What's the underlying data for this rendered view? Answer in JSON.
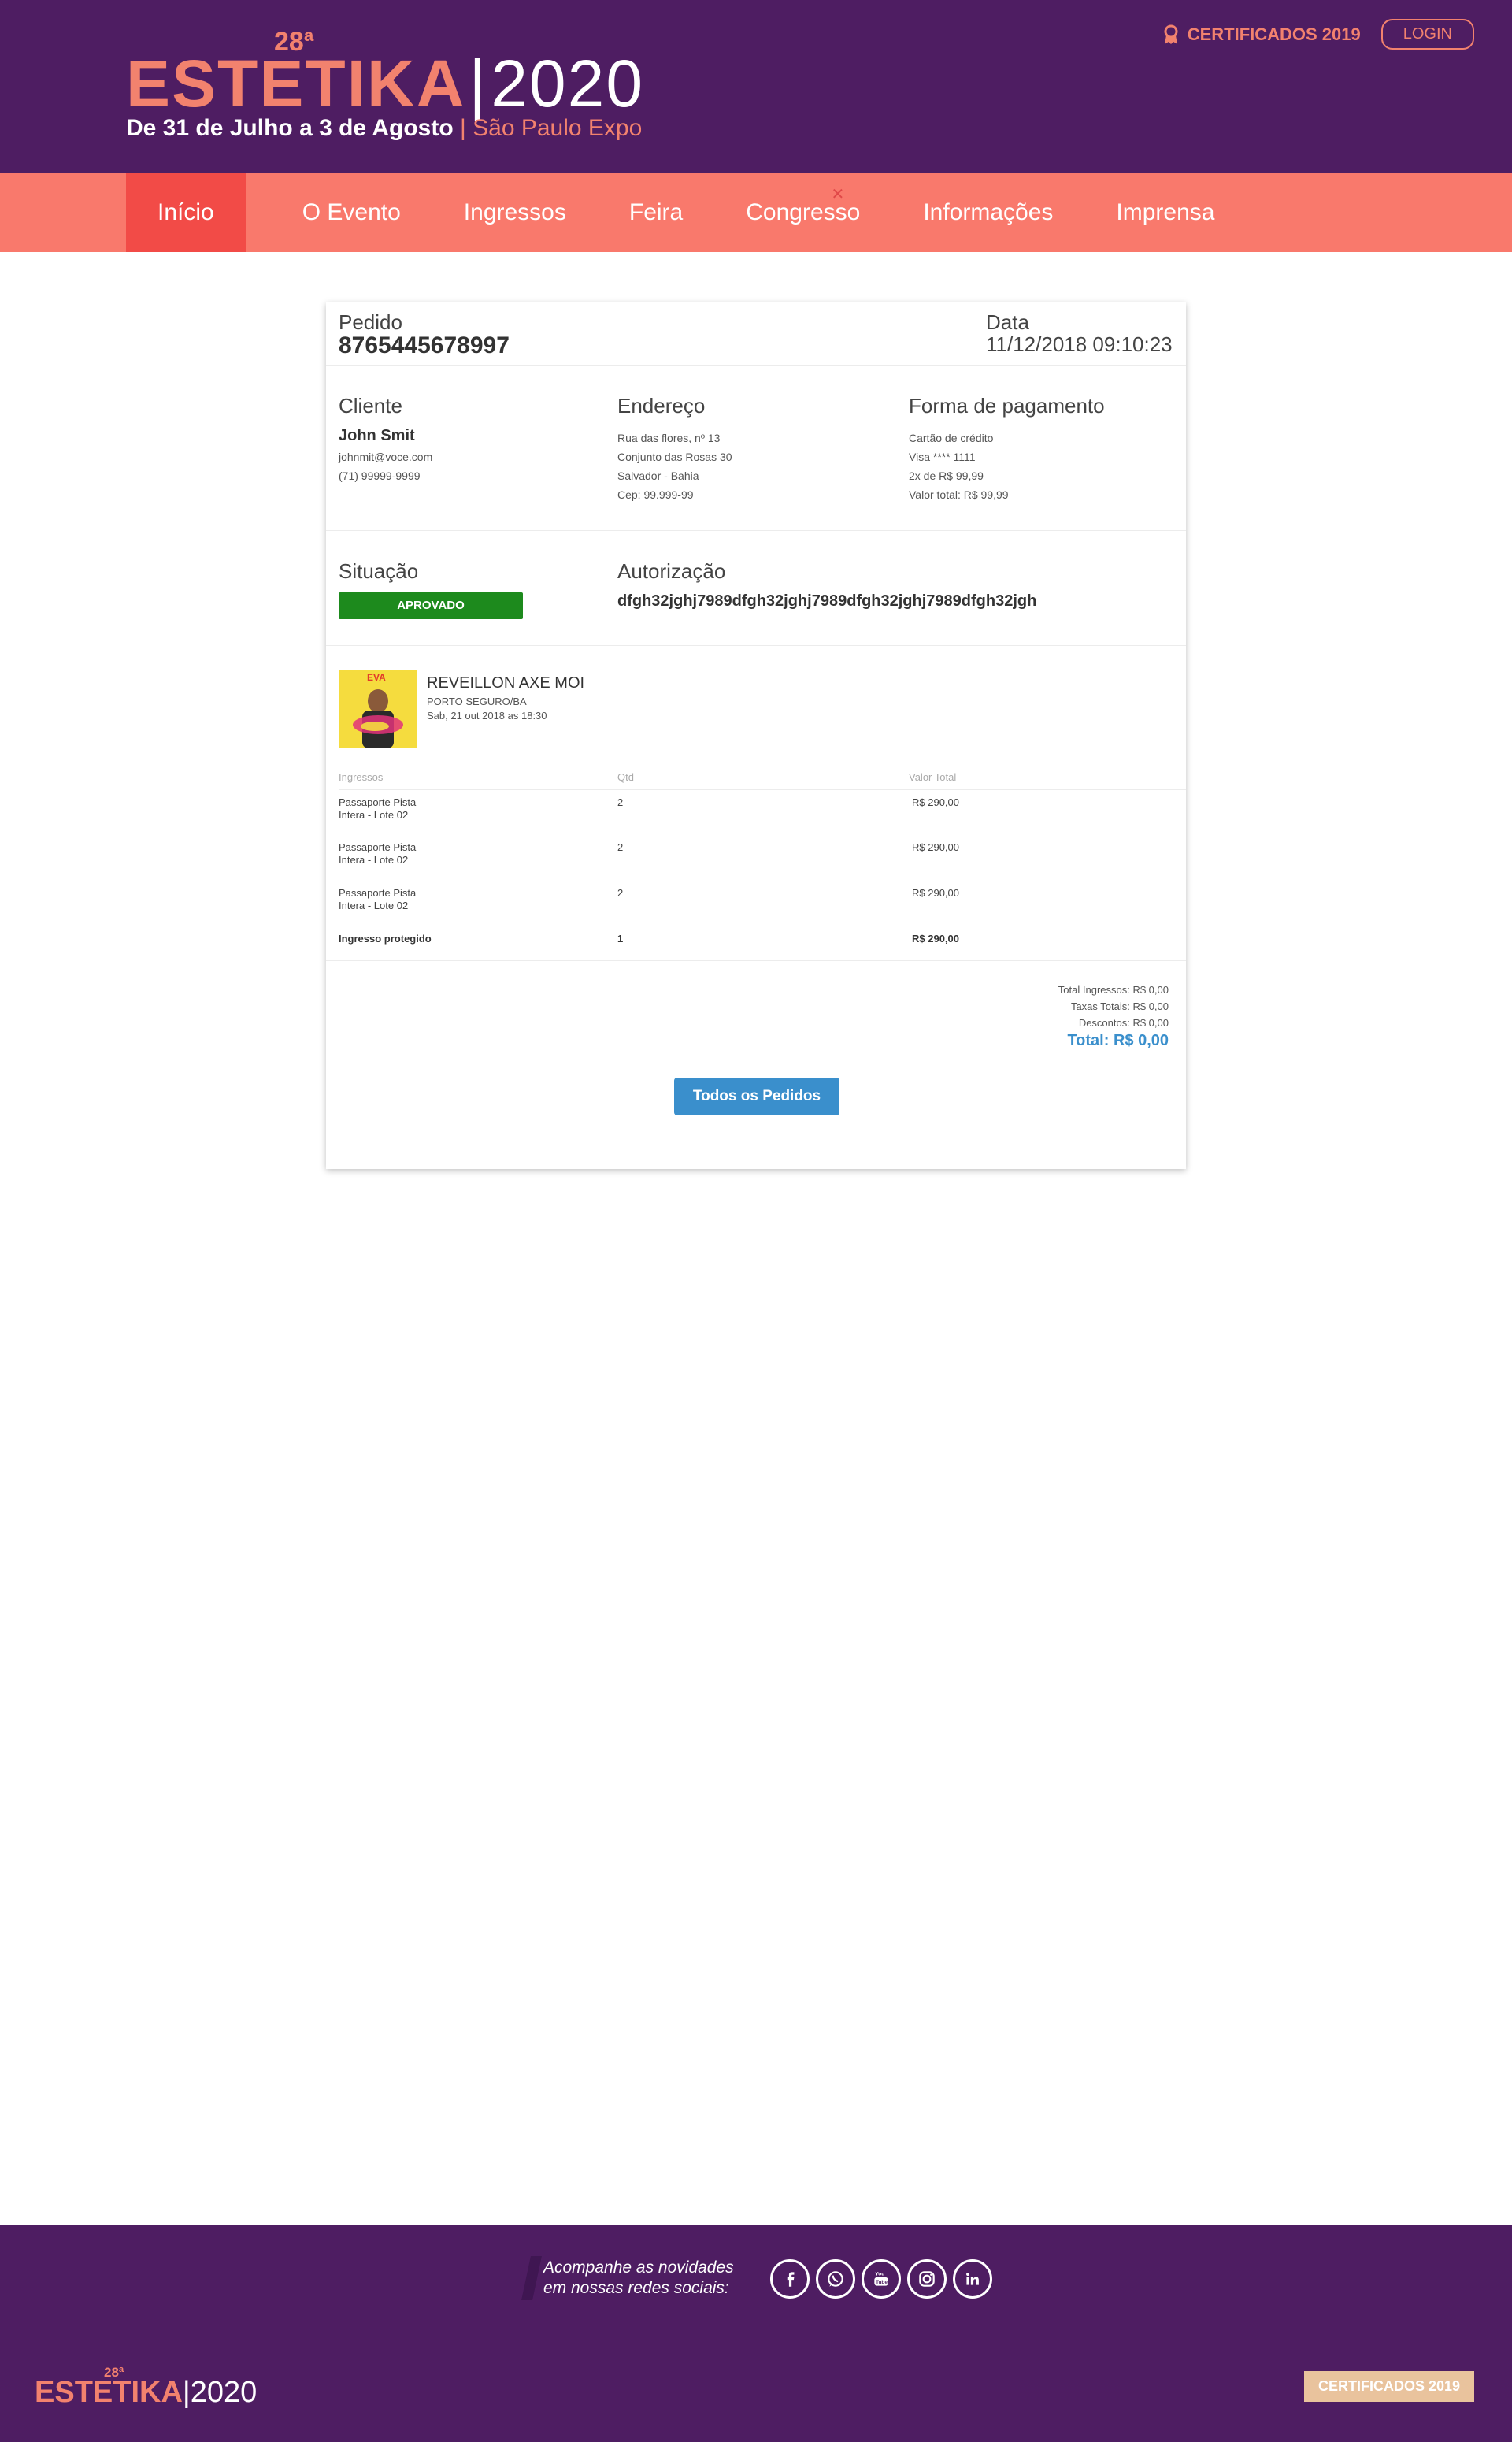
{
  "header": {
    "logo_sup": "28ª",
    "logo_word": "ESTETIKA",
    "logo_year": "2020",
    "dates": "De 31 de Julho a 3 de Agosto",
    "venue": "São Paulo Expo",
    "certificates_label": "CERTIFICADOS 2019",
    "login_label": "LOGIN",
    "brand_color": "#4e1d62",
    "accent_color": "#f2826e"
  },
  "nav": {
    "items": [
      "Início",
      "O Evento",
      "Ingressos",
      "Feira",
      "Congresso",
      "Informações",
      "Imprensa"
    ],
    "active": "Início",
    "close_mark": "✕"
  },
  "order": {
    "pedido_label": "Pedido",
    "pedido_number": "8765445678997",
    "data_label": "Data",
    "data_value": "11/12/2018 09:10:23",
    "cliente_label": "Cliente",
    "cliente_name": "John Smit",
    "cliente_email": "johnmit@voce.com",
    "cliente_phone": "(71) 99999-9999",
    "endereco_label": "Endereço",
    "endereco_lines": [
      "Rua das flores, nº 13",
      "Conjunto das Rosas 30",
      "Salvador - Bahia",
      "Cep: 99.999-99"
    ],
    "pagamento_label": "Forma de pagamento",
    "pagamento_lines": [
      "Cartão de crédito",
      "Visa **** 1111",
      "2x de R$ 99,99",
      "Valor total: R$ 99,99"
    ],
    "situacao_label": "Situação",
    "situacao_value": "APROVADO",
    "autorizacao_label": "Autorização",
    "autorizacao_value": "dfgh32jghj7989dfgh32jghj7989dfgh32jghj7989dfgh32jgh"
  },
  "event": {
    "thumb_logo": "EVA",
    "title": "REVEILLON AXE MOI",
    "location": "PORTO SEGURO/BA",
    "date": "Sab, 21 out 2018 as 18:30"
  },
  "items_table": {
    "headers": [
      "Ingressos",
      "Qtd",
      "Valor Total"
    ],
    "rows": [
      {
        "name_1": "Passaporte Pista",
        "name_2": "Intera - Lote 02",
        "qtd": "2",
        "valor": "R$ 290,00"
      },
      {
        "name_1": "Passaporte Pista",
        "name_2": "Intera - Lote 02",
        "qtd": "2",
        "valor": "R$ 290,00"
      },
      {
        "name_1": "Passaporte Pista",
        "name_2": "Intera - Lote 02",
        "qtd": "2",
        "valor": "R$ 290,00"
      }
    ],
    "protected": {
      "name": "Ingresso protegido",
      "qtd": "1",
      "valor": "R$ 290,00"
    }
  },
  "totals": {
    "ingressos": "Total Ingressos: R$ 0,00",
    "taxas": "Taxas Totais: R$ 0,00",
    "descontos": "Descontos: R$ 0,00",
    "total": "Total: R$ 0,00"
  },
  "actions": {
    "todos_pedidos": "Todos os Pedidos"
  },
  "footer": {
    "follow_line_1": "Acompanhe as novidades",
    "follow_line_2": "em nossas redes sociais:",
    "socials": [
      "facebook-icon",
      "whatsapp-icon",
      "youtube-icon",
      "instagram-icon",
      "linkedin-icon"
    ],
    "logo_sup": "28ª",
    "logo_word": "ESTETIKA",
    "logo_year": "2020",
    "certificates_label": "CERTIFICADOS 2019"
  }
}
